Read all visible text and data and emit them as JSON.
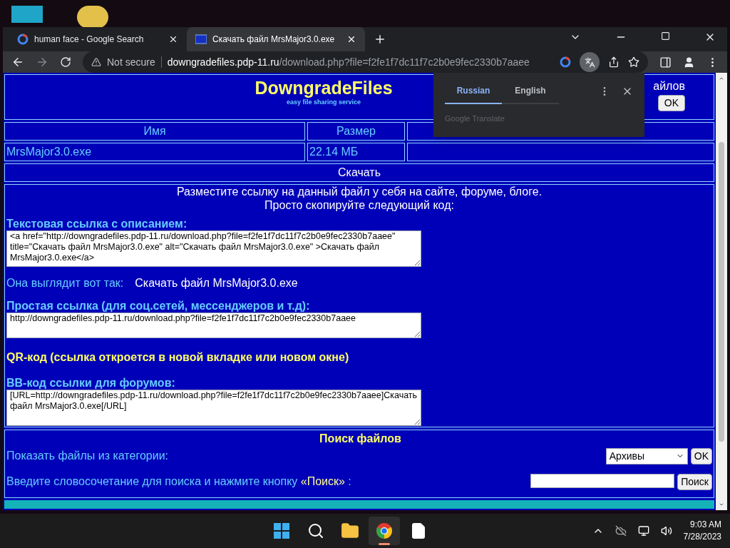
{
  "browser": {
    "tabs": [
      {
        "title": "human face - Google Search",
        "selected": false,
        "kind": "google"
      },
      {
        "title": "Скачать файл MrsMajor3.0.exe",
        "selected": true,
        "kind": "site"
      }
    ],
    "address": {
      "security": "Not secure",
      "host": "downgradefiles.pdp-11.ru",
      "path": "/download.php?file=f2fe1f7dc11f7c2b0e9fec2330b7aaee"
    }
  },
  "page": {
    "header": {
      "logo": "DowngradeFiles",
      "tagline": "easy file sharing service",
      "side_label": "айлов",
      "button": "OK"
    },
    "table": {
      "columns": [
        "Имя",
        "Размер"
      ],
      "row": [
        "MrsMajor3.0.exe",
        "22.14 МБ"
      ]
    },
    "download": "Скачать",
    "intro": [
      "Разместите ссылку на данный файл у себя на сайте, форуме, блоге.",
      "Просто скопируйте следующий код:"
    ],
    "sections": [
      {
        "kind": "code",
        "label": "Текстовая ссылка с описанием:",
        "value": "<a href=\"http://downgradefiles.pdp-11.ru/download.php?file=f2fe1f7dc11f7c2b0e9fec2330b7aaee\" title=\"Скачать файл MrsMajor3.0.exe\" alt=\"Скачать файл MrsMajor3.0.exe\" >Скачать файл MrsMajor3.0.exe</a>"
      },
      {
        "kind": "preview",
        "label": "Она выглядит вот так:",
        "value": "Скачать файл MrsMajor3.0.exe"
      },
      {
        "kind": "code",
        "label": "Простая ссылка (для соц.сетей, мессенджеров и т.д):",
        "value": "http://downgradefiles.pdp-11.ru/download.php?file=f2fe1f7dc11f7c2b0e9fec2330b7aaee"
      },
      {
        "kind": "heading",
        "label": "QR-код (ссылка откроется в новой вкладке или новом окне)"
      },
      {
        "kind": "code",
        "label": "BB-код ссылки для форумов:",
        "value": "[URL=http://downgradefiles.pdp-11.ru/download.php?file=f2fe1f7dc11f7c2b0e9fec2330b7aaee]Скачать файл MrsMajor3.0.exe[/URL]"
      }
    ],
    "search": {
      "title": "Поиск файлов",
      "category_label": "Показать файлы из категории:",
      "category": "Архивы",
      "ok": "OK",
      "query_label": "Введите словосочетание для поиска и нажмите кнопку ",
      "query_highlight": "«Поиск»",
      "query_suffix": " :",
      "button": "Поиск"
    }
  },
  "translate": {
    "languages": [
      {
        "name": "Russian",
        "selected": true
      },
      {
        "name": "English",
        "selected": false
      }
    ],
    "brand": "Google Translate"
  },
  "taskbar": {
    "apps": [
      {
        "kind": "start",
        "active": false
      },
      {
        "kind": "search",
        "active": false
      },
      {
        "kind": "folder",
        "active": false
      },
      {
        "kind": "chrome",
        "active": true
      },
      {
        "kind": "file",
        "active": false
      }
    ],
    "time": "9:03 AM",
    "date": "7/28/2023"
  }
}
